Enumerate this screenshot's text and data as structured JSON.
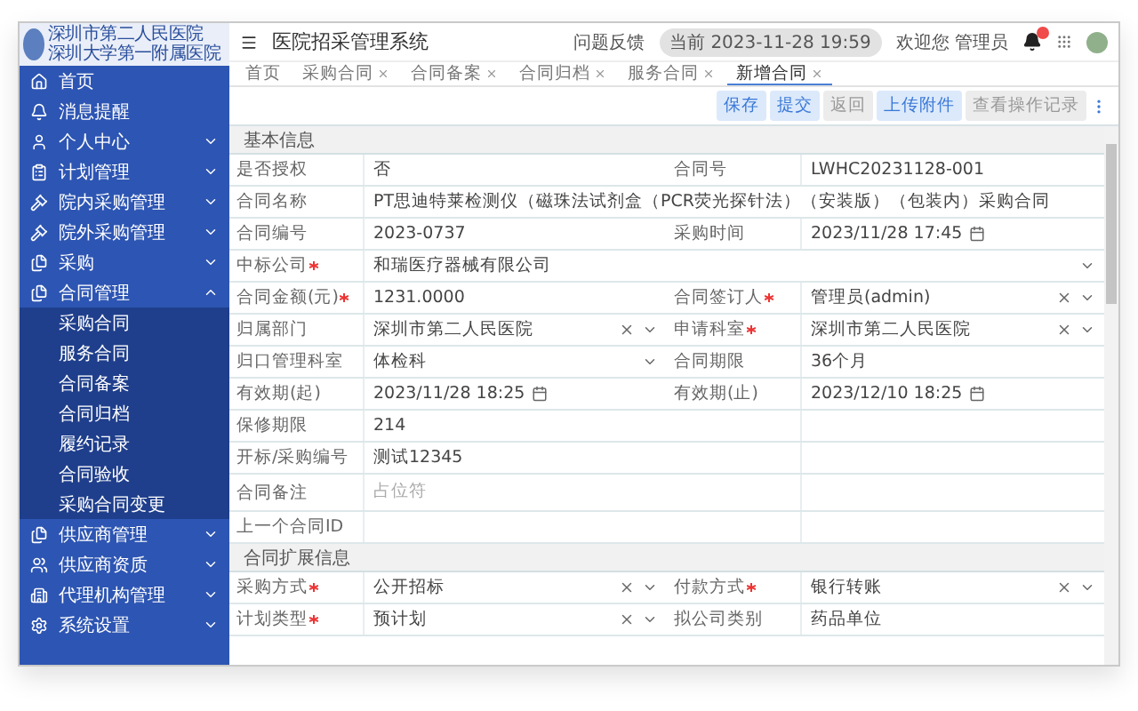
{
  "sidebar": {
    "logo": [
      "深圳市第二人民医院",
      "深圳大学第一附属医院"
    ],
    "items": [
      {
        "label": "首页",
        "has_children": false
      },
      {
        "label": "消息提醒",
        "has_children": false
      },
      {
        "label": "个人中心",
        "expanded": false,
        "has_children": true
      },
      {
        "label": "计划管理",
        "expanded": false,
        "has_children": true
      },
      {
        "label": "院内采购管理",
        "expanded": false,
        "has_children": true
      },
      {
        "label": "院外采购管理",
        "expanded": false,
        "has_children": true
      },
      {
        "label": "采购",
        "expanded": false,
        "has_children": true
      },
      {
        "label": "合同管理",
        "expanded": true,
        "has_children": true,
        "children": [
          {
            "label": "采购合同"
          },
          {
            "label": "服务合同"
          },
          {
            "label": "合同备案"
          },
          {
            "label": "合同归档"
          },
          {
            "label": "履约记录"
          },
          {
            "label": "合同验收"
          },
          {
            "label": "采购合同变更"
          }
        ]
      },
      {
        "label": "供应商管理",
        "expanded": false,
        "has_children": true
      },
      {
        "label": "供应商资质",
        "expanded": false,
        "has_children": true
      },
      {
        "label": "代理机构管理",
        "expanded": false,
        "has_children": true
      },
      {
        "label": "系统设置",
        "expanded": false,
        "has_children": true
      }
    ]
  },
  "header": {
    "title": "医院招采管理系统",
    "feedback": "问题反馈",
    "clock": "当前 2023-11-28 19:59",
    "user": "欢迎您 管理员",
    "notifications_badge": true
  },
  "tabs": [
    {
      "label": "首页",
      "closable": false,
      "selected": false
    },
    {
      "label": "采购合同",
      "closable": true,
      "selected": false
    },
    {
      "label": "合同备案",
      "closable": true,
      "selected": false
    },
    {
      "label": "合同归档",
      "closable": true,
      "selected": false
    },
    {
      "label": "服务合同",
      "closable": true,
      "selected": false
    },
    {
      "label": "新增合同",
      "closable": true,
      "selected": true
    }
  ],
  "toolbar": [
    {
      "label": "保存",
      "kind": "primary"
    },
    {
      "label": "提交",
      "kind": "primary"
    },
    {
      "label": "返回",
      "kind": "plain"
    },
    {
      "label": "上传附件",
      "kind": "primary"
    },
    {
      "label": "查看操作记录",
      "kind": "plain"
    }
  ],
  "sections": [
    {
      "title": "基本信息",
      "rows": [
        [
          {
            "label": "是否授权",
            "required": false,
            "kind": "text",
            "value": "否"
          },
          {
            "label": "合同号",
            "required": false,
            "kind": "text",
            "value": "LWHC20231128-001"
          }
        ],
        [
          {
            "label": "合同名称",
            "required": false,
            "kind": "text",
            "wide": true,
            "value": "PT思迪特莱检测仪（磁珠法试剂盒（PCR荧光探针法）（安装版）（包装内）采购合同"
          }
        ],
        [
          {
            "label": "合同编号",
            "required": false,
            "kind": "text",
            "value": "2023-0737"
          },
          {
            "label": "采购时间",
            "required": false,
            "kind": "date",
            "value": "2023/11/28 17:45"
          }
        ],
        [
          {
            "label": "中标公司",
            "required": true,
            "kind": "select",
            "clearable": false,
            "wide": true,
            "value": "和瑞医疗器械有限公司"
          }
        ],
        [
          {
            "label": "合同金额(元)",
            "required": true,
            "kind": "text",
            "value": "1231.0000"
          },
          {
            "label": "合同签订人",
            "required": true,
            "kind": "select",
            "clearable": true,
            "value": "管理员(admin)"
          }
        ],
        [
          {
            "label": "归属部门",
            "required": false,
            "kind": "select",
            "clearable": true,
            "value": "深圳市第二人民医院"
          },
          {
            "label": "申请科室",
            "required": true,
            "kind": "select",
            "clearable": true,
            "value": "深圳市第二人民医院"
          }
        ],
        [
          {
            "label": "归口管理科室",
            "required": false,
            "kind": "select",
            "clearable": false,
            "value": "体检科"
          },
          {
            "label": "合同期限",
            "required": false,
            "kind": "text",
            "value": "36个月"
          }
        ],
        [
          {
            "label": "有效期(起)",
            "required": false,
            "kind": "date",
            "value": "2023/11/28 18:25"
          },
          {
            "label": "有效期(止)",
            "required": false,
            "kind": "date",
            "value": "2023/12/10 18:25"
          }
        ],
        [
          {
            "label": "保修期限",
            "required": false,
            "kind": "text",
            "value": "214"
          }
        ],
        [
          {
            "label": "开标/采购编号",
            "required": false,
            "kind": "text",
            "value": "测试12345"
          }
        ],
        [
          {
            "label": "合同备注",
            "required": false,
            "kind": "textarea",
            "placeholder": "占位符"
          }
        ],
        [
          {
            "label": "上一个合同ID",
            "required": false,
            "kind": "text"
          }
        ]
      ]
    },
    {
      "title": "合同扩展信息",
      "rows": [
        [
          {
            "label": "采购方式",
            "required": true,
            "kind": "select",
            "clearable": true,
            "value": "公开招标"
          },
          {
            "label": "付款方式",
            "required": true,
            "kind": "select",
            "clearable": true,
            "value": "银行转账"
          }
        ],
        [
          {
            "label": "计划类型",
            "required": true,
            "kind": "select",
            "clearable": true,
            "value": "预计划"
          },
          {
            "label": "拟公司类别",
            "required": false,
            "kind": "text",
            "value": "药品单位"
          }
        ]
      ]
    }
  ]
}
